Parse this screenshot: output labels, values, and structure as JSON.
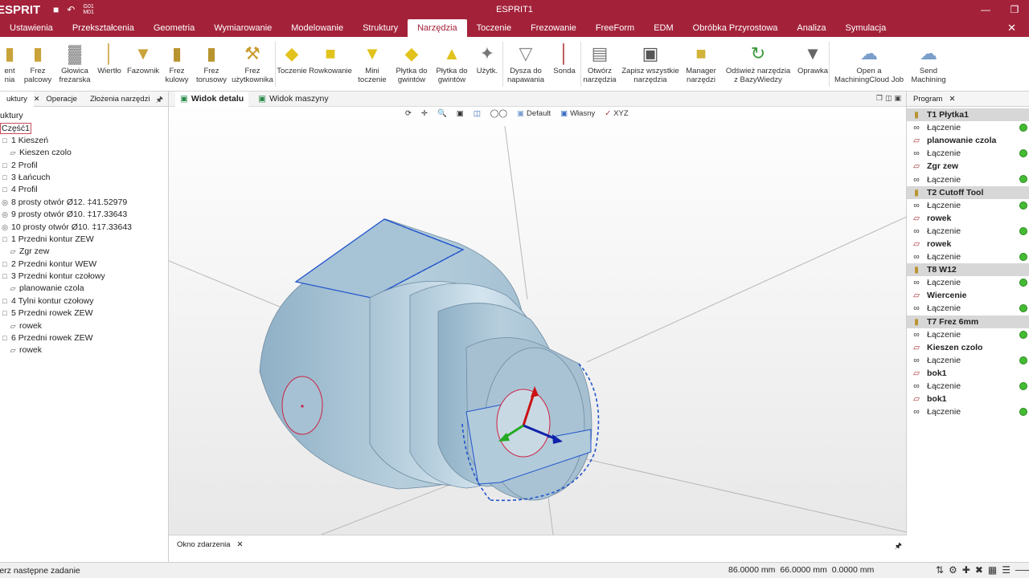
{
  "app": {
    "logo": "ESPRIT",
    "title": "ESPRIT1",
    "gcode_label": "G01\nM01"
  },
  "colors": {
    "brand": "#a3223a",
    "active_dot": "#44bb33",
    "selection": "#2255cc"
  },
  "ribbon_tabs": [
    "Ustawienia",
    "Przekształcenia",
    "Geometria",
    "Wymiarowanie",
    "Modelowanie",
    "Struktury",
    "Narzędzia",
    "Toczenie",
    "Frezowanie",
    "FreeForm",
    "EDM",
    "Obróbka Przyrostowa",
    "Analiza",
    "Symulacja"
  ],
  "active_tab": "Narzędzia",
  "ribbon_buttons": [
    {
      "label": "ent\nnia",
      "icon": "tool-icon"
    },
    {
      "label": "Frez\npalcowy",
      "icon": "end-mill-icon"
    },
    {
      "label": "Głowica\nfrezarska",
      "icon": "face-mill-icon"
    },
    {
      "label": "Wiertło",
      "icon": "drill-icon"
    },
    {
      "label": "Fazownik",
      "icon": "chamfer-icon"
    },
    {
      "label": "Frez\nkulowy",
      "icon": "ball-mill-icon"
    },
    {
      "label": "Frez\ntorusowy",
      "icon": "torus-mill-icon"
    },
    {
      "label": "Frez\nużytkownika",
      "icon": "custom-mill-icon"
    },
    {
      "label": "Toczenie",
      "icon": "turning-insert-icon"
    },
    {
      "label": "Rowkowanie",
      "icon": "grooving-icon"
    },
    {
      "label": "Mini\ntoczenie",
      "icon": "mini-turning-icon"
    },
    {
      "label": "Płytka do\ngwintów",
      "icon": "thread-insert-icon"
    },
    {
      "label": "Płytka do\ngwintów",
      "icon": "thread-insert2-icon"
    },
    {
      "label": "Użytk.",
      "icon": "user-tool-icon"
    },
    {
      "label": "Dysza do\nnapawania",
      "icon": "nozzle-icon"
    },
    {
      "label": "Sonda",
      "icon": "probe-icon"
    },
    {
      "label": "Otwórz\nnarzędzia",
      "icon": "open-tools-icon"
    },
    {
      "label": "Zapisz wszystkie\nnarzędzia",
      "icon": "save-tools-icon"
    },
    {
      "label": "Manager\nnarzędzi",
      "icon": "tool-manager-icon"
    },
    {
      "label": "Odśwież narzędzia\nz BazyWiedzy",
      "icon": "refresh-tools-icon"
    },
    {
      "label": "Oprawka",
      "icon": "holder-icon"
    },
    {
      "label": "Open a\nMachiningCloud Job",
      "icon": "cloud-open-icon"
    },
    {
      "label": "Send\nMachining",
      "icon": "cloud-send-icon"
    }
  ],
  "left_panel": {
    "tabs": [
      "uktury",
      "Operacje",
      "Złożenia narzędzi"
    ],
    "tree": [
      {
        "label": "uktury",
        "indent": 0,
        "icon": ""
      },
      {
        "label": "Część1",
        "indent": 0,
        "icon": "",
        "selected": true
      },
      {
        "label": "1 Kieszeń",
        "indent": 1,
        "icon": "feature-icon"
      },
      {
        "label": "Kieszen czolo",
        "indent": 2,
        "icon": "operation-icon"
      },
      {
        "label": "2 Profil",
        "indent": 1,
        "icon": "feature-icon"
      },
      {
        "label": "3 Łańcuch",
        "indent": 1,
        "icon": "feature-icon"
      },
      {
        "label": "4 Profil",
        "indent": 1,
        "icon": "feature-icon"
      },
      {
        "label": "8 prosty otwór Ø12. ‡41.52979",
        "indent": 1,
        "icon": "hole-icon"
      },
      {
        "label": "9 prosty otwór Ø10. ‡17.33643",
        "indent": 1,
        "icon": "hole-icon"
      },
      {
        "label": "10 prosty otwór Ø10. ‡17.33643",
        "indent": 1,
        "icon": "hole-icon"
      },
      {
        "label": "1 Przedni kontur ZEW",
        "indent": 1,
        "icon": "feature-icon"
      },
      {
        "label": "Zgr zew",
        "indent": 2,
        "icon": "operation-icon"
      },
      {
        "label": "2 Przedni kontur WEW",
        "indent": 1,
        "icon": "feature-icon"
      },
      {
        "label": "3 Przedni kontur czołowy",
        "indent": 1,
        "icon": "feature-icon"
      },
      {
        "label": "planowanie czola",
        "indent": 2,
        "icon": "operation-icon"
      },
      {
        "label": "4 Tylni kontur czołowy",
        "indent": 1,
        "icon": "feature-icon"
      },
      {
        "label": "5 Przedni rowek ZEW",
        "indent": 1,
        "icon": "feature-icon"
      },
      {
        "label": "rowek",
        "indent": 2,
        "icon": "operation-icon"
      },
      {
        "label": "6 Przedni rowek ZEW",
        "indent": 1,
        "icon": "feature-icon"
      },
      {
        "label": "rowek",
        "indent": 2,
        "icon": "operation-icon"
      }
    ]
  },
  "viewport": {
    "tabs": [
      "Widok detalu",
      "Widok maszyny"
    ],
    "view_default": "Default",
    "view_custom": "Własny",
    "view_xyz": "XYZ"
  },
  "event_window": {
    "tab": "Okno zdarzenia"
  },
  "right_panel": {
    "tab": "Program",
    "rows": [
      {
        "label": "T1 Płytka1",
        "type": "tool"
      },
      {
        "label": "Łączenie",
        "type": "link",
        "dot": true
      },
      {
        "label": "planowanie czola",
        "type": "op"
      },
      {
        "label": "Łączenie",
        "type": "link",
        "dot": true
      },
      {
        "label": "Zgr zew",
        "type": "op"
      },
      {
        "label": "Łączenie",
        "type": "link",
        "dot": true
      },
      {
        "label": "T2 Cutoff Tool",
        "type": "tool"
      },
      {
        "label": "Łączenie",
        "type": "link",
        "dot": true
      },
      {
        "label": "rowek",
        "type": "op"
      },
      {
        "label": "Łączenie",
        "type": "link",
        "dot": true
      },
      {
        "label": "rowek",
        "type": "op"
      },
      {
        "label": "Łączenie",
        "type": "link",
        "dot": true
      },
      {
        "label": "T8 W12",
        "type": "tool"
      },
      {
        "label": "Łączenie",
        "type": "link",
        "dot": true
      },
      {
        "label": "Wiercenie",
        "type": "op"
      },
      {
        "label": "Łączenie",
        "type": "link",
        "dot": true
      },
      {
        "label": "T7 Frez 6mm",
        "type": "tool"
      },
      {
        "label": "Łączenie",
        "type": "link",
        "dot": true
      },
      {
        "label": "Kieszen czolo",
        "type": "op"
      },
      {
        "label": "Łączenie",
        "type": "link",
        "dot": true
      },
      {
        "label": "bok1",
        "type": "op"
      },
      {
        "label": "Łączenie",
        "type": "link",
        "dot": true
      },
      {
        "label": "bok1",
        "type": "op"
      },
      {
        "label": "Łączenie",
        "type": "link",
        "dot": true
      }
    ]
  },
  "status": {
    "message": "ierz następne zadanie",
    "x": "86.0000 mm",
    "y": "66.0000 mm",
    "z": "0.0000 mm"
  }
}
